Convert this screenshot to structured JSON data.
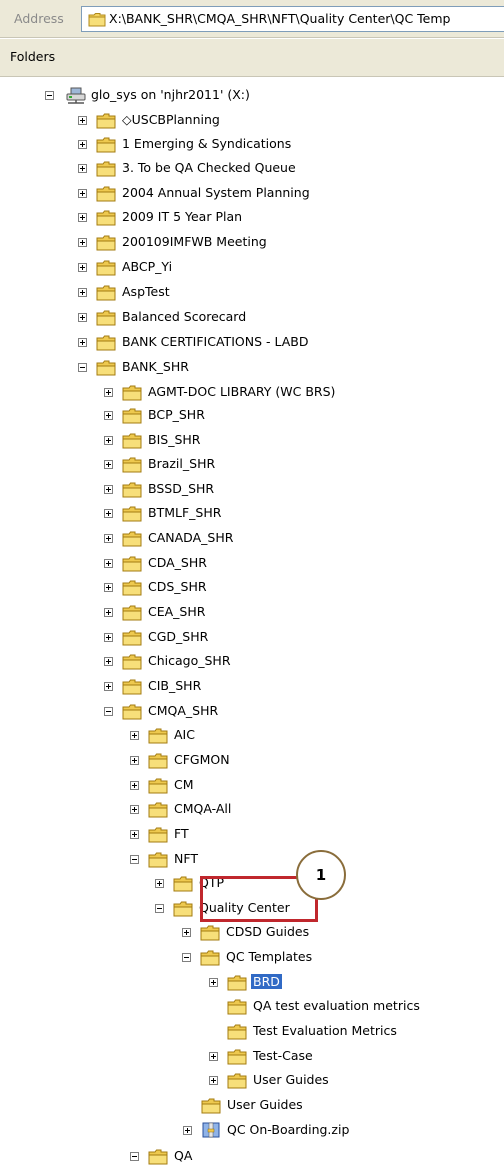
{
  "address_bar": {
    "label": "Address",
    "path": "X:\\BANK_SHR\\CMQA_SHR\\NFT\\Quality Center\\QC Temp"
  },
  "folders_pane": {
    "title": "Folders"
  },
  "tree": [
    {
      "label": "glo_sys on 'njhr2011' (X:)",
      "state": "expanded",
      "icon": "network-drive-icon",
      "selected": false
    },
    {
      "label": "◇USCBPlanning",
      "state": "collapsed",
      "icon": "folder-icon",
      "selected": false
    },
    {
      "label": "1 Emerging & Syndications",
      "state": "collapsed",
      "icon": "folder-icon",
      "selected": false
    },
    {
      "label": "3. To be QA Checked Queue",
      "state": "collapsed",
      "icon": "folder-icon",
      "selected": false
    },
    {
      "label": "2004 Annual System Planning",
      "state": "collapsed",
      "icon": "folder-icon",
      "selected": false
    },
    {
      "label": "2009 IT 5 Year Plan",
      "state": "collapsed",
      "icon": "folder-icon",
      "selected": false
    },
    {
      "label": "200109IMFWB Meeting",
      "state": "collapsed",
      "icon": "folder-icon",
      "selected": false
    },
    {
      "label": "ABCP_Yi",
      "state": "collapsed",
      "icon": "folder-icon",
      "selected": false
    },
    {
      "label": "AspTest",
      "state": "collapsed",
      "icon": "folder-icon",
      "selected": false
    },
    {
      "label": "Balanced Scorecard",
      "state": "collapsed",
      "icon": "folder-icon",
      "selected": false
    },
    {
      "label": "BANK CERTIFICATIONS - LABD",
      "state": "collapsed",
      "icon": "folder-icon",
      "selected": false
    },
    {
      "label": "BANK_SHR",
      "state": "expanded",
      "icon": "folder-icon",
      "selected": false
    },
    {
      "label": "AGMT-DOC LIBRARY (WC BRS)",
      "state": "collapsed",
      "icon": "folder-icon",
      "selected": false
    },
    {
      "label": "BCP_SHR",
      "state": "collapsed",
      "icon": "folder-icon",
      "selected": false
    },
    {
      "label": "BIS_SHR",
      "state": "collapsed",
      "icon": "folder-icon",
      "selected": false
    },
    {
      "label": "Brazil_SHR",
      "state": "collapsed",
      "icon": "folder-icon",
      "selected": false
    },
    {
      "label": "BSSD_SHR",
      "state": "collapsed",
      "icon": "folder-icon",
      "selected": false
    },
    {
      "label": "BTMLF_SHR",
      "state": "collapsed",
      "icon": "folder-icon",
      "selected": false
    },
    {
      "label": "CANADA_SHR",
      "state": "collapsed",
      "icon": "folder-icon",
      "selected": false
    },
    {
      "label": "CDA_SHR",
      "state": "collapsed",
      "icon": "folder-icon",
      "selected": false
    },
    {
      "label": "CDS_SHR",
      "state": "collapsed",
      "icon": "folder-icon",
      "selected": false
    },
    {
      "label": "CEA_SHR",
      "state": "collapsed",
      "icon": "folder-icon",
      "selected": false
    },
    {
      "label": "CGD_SHR",
      "state": "collapsed",
      "icon": "folder-icon",
      "selected": false
    },
    {
      "label": "Chicago_SHR",
      "state": "collapsed",
      "icon": "folder-icon",
      "selected": false
    },
    {
      "label": "CIB_SHR",
      "state": "collapsed",
      "icon": "folder-icon",
      "selected": false
    },
    {
      "label": "CMQA_SHR",
      "state": "expanded",
      "icon": "folder-icon",
      "selected": false
    },
    {
      "label": "AIC",
      "state": "collapsed",
      "icon": "folder-icon",
      "selected": false
    },
    {
      "label": "CFGMON",
      "state": "collapsed",
      "icon": "folder-icon",
      "selected": false
    },
    {
      "label": "CM",
      "state": "collapsed",
      "icon": "folder-icon",
      "selected": false
    },
    {
      "label": "CMQA-All",
      "state": "collapsed",
      "icon": "folder-icon",
      "selected": false
    },
    {
      "label": "FT",
      "state": "collapsed",
      "icon": "folder-icon",
      "selected": false
    },
    {
      "label": "NFT",
      "state": "expanded",
      "icon": "folder-icon",
      "selected": false
    },
    {
      "label": "QTP",
      "state": "collapsed",
      "icon": "folder-icon",
      "selected": false
    },
    {
      "label": "Quality Center",
      "state": "expanded",
      "icon": "folder-icon",
      "selected": false
    },
    {
      "label": "CDSD Guides",
      "state": "collapsed",
      "icon": "folder-icon",
      "selected": false
    },
    {
      "label": "QC Templates",
      "state": "expanded",
      "icon": "folder-icon",
      "selected": false
    },
    {
      "label": "BRD",
      "state": "collapsed",
      "icon": "folder-icon",
      "selected": true
    },
    {
      "label": "QA test evaluation metrics",
      "state": "none",
      "icon": "folder-icon",
      "selected": false
    },
    {
      "label": "Test Evaluation Metrics",
      "state": "none",
      "icon": "folder-icon",
      "selected": false
    },
    {
      "label": "Test-Case",
      "state": "collapsed",
      "icon": "folder-icon",
      "selected": false
    },
    {
      "label": "User Guides",
      "state": "collapsed",
      "icon": "folder-icon",
      "selected": false
    },
    {
      "label": "User Guides",
      "state": "none",
      "icon": "folder-icon",
      "selected": false
    },
    {
      "label": "QC On-Boarding.zip",
      "state": "collapsed",
      "icon": "zip-folder-icon",
      "selected": false
    },
    {
      "label": "QA",
      "state": "expanded",
      "icon": "folder-icon",
      "selected": false
    }
  ],
  "callout": {
    "number": "1",
    "color": "#c0272d"
  },
  "colors": {
    "selection": "#316ac5",
    "folder": "#f4d35e",
    "chrome": "#ece9d8"
  }
}
